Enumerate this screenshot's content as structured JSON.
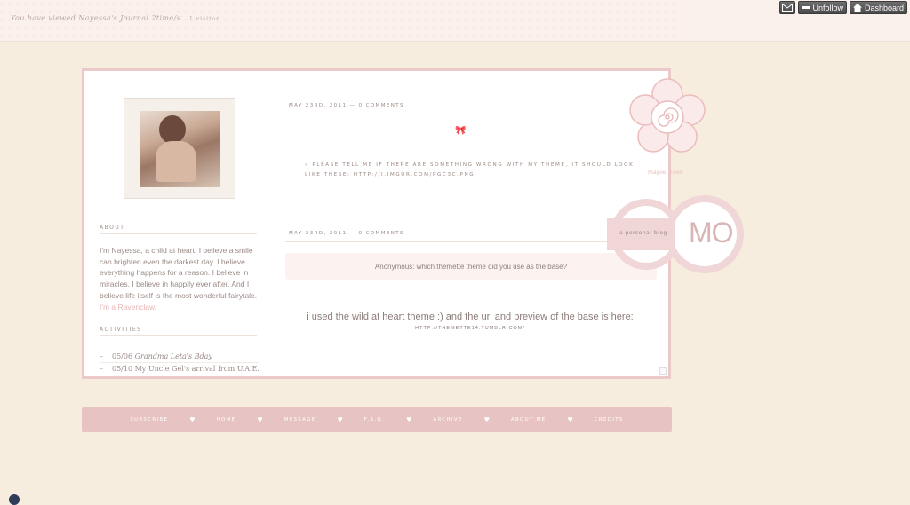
{
  "topbar": {
    "view_text": "You have viewed Nayessa's Journal 2time/s.",
    "visitor_text": "1 visitor",
    "buttons": [
      {
        "label": "",
        "icon": "mail-icon"
      },
      {
        "label": "Unfollow",
        "icon": "minus-icon"
      },
      {
        "label": "Dashboard",
        "icon": "home-icon"
      }
    ]
  },
  "sidebar": {
    "about_label": "ABOUT",
    "about_text": "I'm Nayessa, a child at heart. I believe a smile can brighten even the darkest day. I believe everything happens for a reason. I believe in miracles. I believe in happily ever after. And I believe life itself is the most wonderful fairytale.",
    "about_link": "I'm a Ravenclaw.",
    "activities_label": "ACTIVITIES",
    "activities": [
      {
        "date": "05/06",
        "text": "Grandma Leta's Bday",
        "italic": true
      },
      {
        "date": "05/10",
        "text": "My Uncle Gel's arrival from U.A.E.",
        "italic": false
      }
    ]
  },
  "posts": [
    {
      "meta": "MAY 23RD, 2011 — 0 COMMENTS",
      "bow": "🎀",
      "text": "» PLEASE TELL ME IF THERE ARE SOMETHING WRONG WITH MY THEME, IT SHOULD LOOK LIKE THESE: HTTP://I.IMGUR.COM/PGC3C.PNG"
    },
    {
      "meta": "MAY 23RD, 2011 — 0 COMMENTS",
      "ask": "Anonymous: which themette theme did you use as the base?",
      "answer": "i used the wild at heart theme :) and the url and preview of the base is here:",
      "answer_url": "HTTP://THEMETTE14.TUMBLR.COM/"
    }
  ],
  "decor": {
    "flower_caption": "maple, cook",
    "logo_tag": "a personal blog",
    "logo_text": "MO"
  },
  "nav": {
    "items": [
      "SUBSCRIBE",
      "HOME",
      "MESSAGE",
      "F.A.Q.",
      "ARCHIVE",
      "ABOUT ME",
      "CREDITS"
    ],
    "separator": "♥"
  },
  "colors": {
    "background": "#f7eddf",
    "accent_pink": "#e7c3c3",
    "card_border": "#ecc9c9",
    "text": "#9b8b86"
  }
}
